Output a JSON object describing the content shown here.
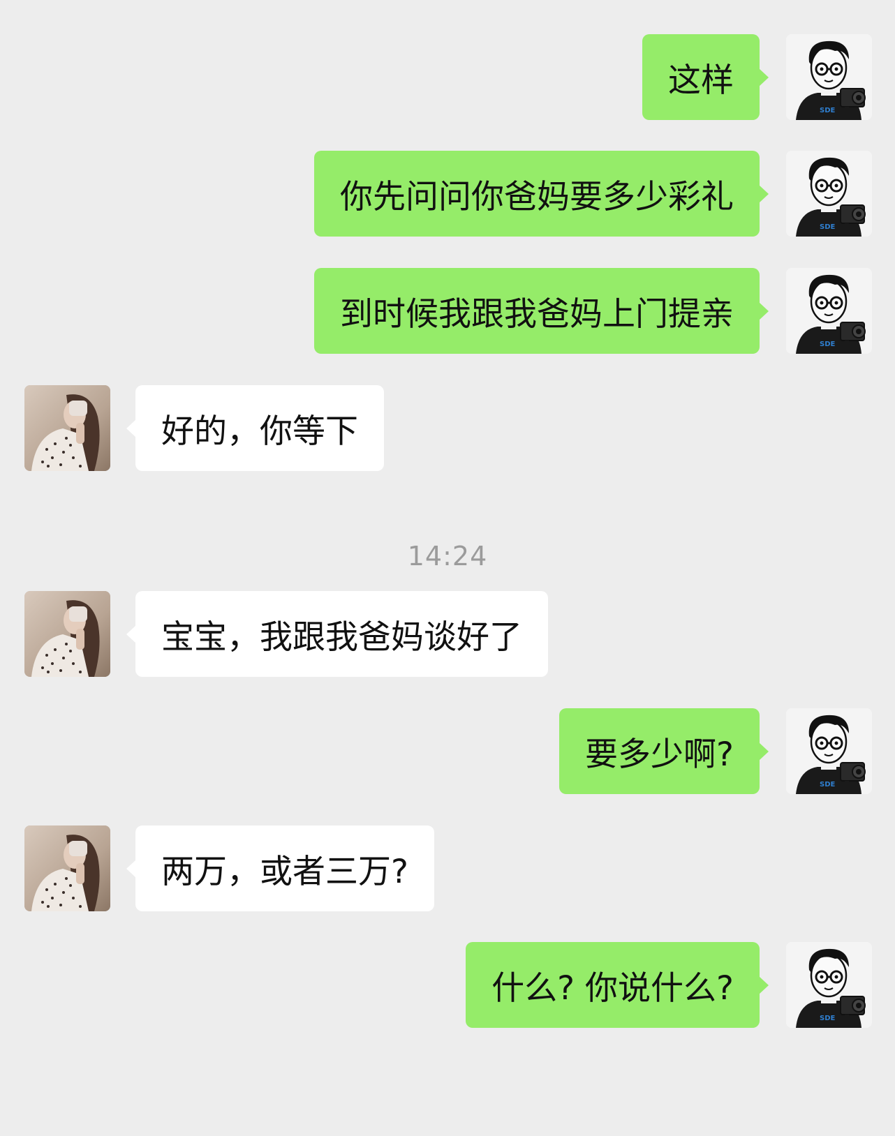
{
  "chat": {
    "messages": [
      {
        "from": "me",
        "text": "这样"
      },
      {
        "from": "me",
        "text": "你先问问你爸妈要多少彩礼"
      },
      {
        "from": "me",
        "text": "到时候我跟我爸妈上门提亲"
      },
      {
        "from": "her",
        "text": "好的，你等下"
      },
      {
        "from": "her",
        "text": "宝宝，我跟我爸妈谈好了"
      },
      {
        "from": "me",
        "text": "要多少啊?"
      },
      {
        "from": "her",
        "text": "两万，或者三万?"
      },
      {
        "from": "me",
        "text": "什么? 你说什么?"
      }
    ],
    "timestamp": "14:24"
  },
  "colors": {
    "background": "#ededed",
    "sent_bubble": "#95ec69",
    "received_bubble": "#ffffff",
    "timestamp": "#9b9b9b"
  },
  "icons": {
    "me_avatar": "cartoon-man-with-glasses-and-camera",
    "her_avatar": "woman-selfie-photo"
  }
}
